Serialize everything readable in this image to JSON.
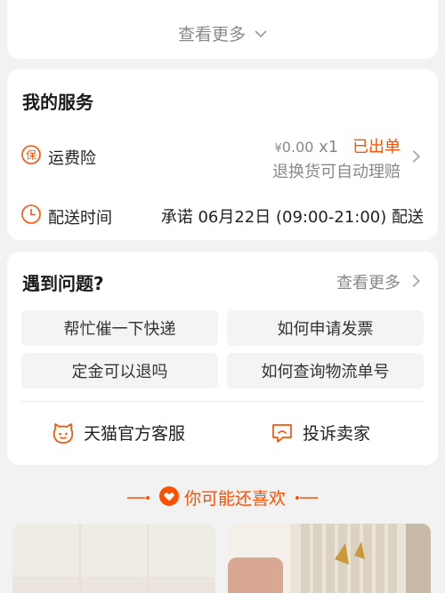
{
  "top_card": {
    "see_more": "查看更多"
  },
  "service": {
    "title": "我的服务",
    "insurance": {
      "icon_glyph": "保",
      "label": "运费险",
      "price_symbol": "¥",
      "price": "0.00",
      "quantity": "x1",
      "status": "已出单",
      "subtitle": "退换货可自动理赔"
    },
    "delivery": {
      "label": "配送时间",
      "value": "承诺 06月22日 (09:00-21:00) 配送"
    }
  },
  "problems": {
    "title": "遇到问题?",
    "see_more": "查看更多",
    "faqs": [
      "帮忙催一下快递",
      "如何申请发票",
      "定金可以退吗",
      "如何查询物流单号"
    ],
    "customer_service": "天猫官方客服",
    "complain": "投诉卖家"
  },
  "recommend": {
    "title": "你可能还喜欢"
  },
  "colors": {
    "accent": "#ff5000",
    "background": "#f2f2f2",
    "card": "#ffffff"
  }
}
